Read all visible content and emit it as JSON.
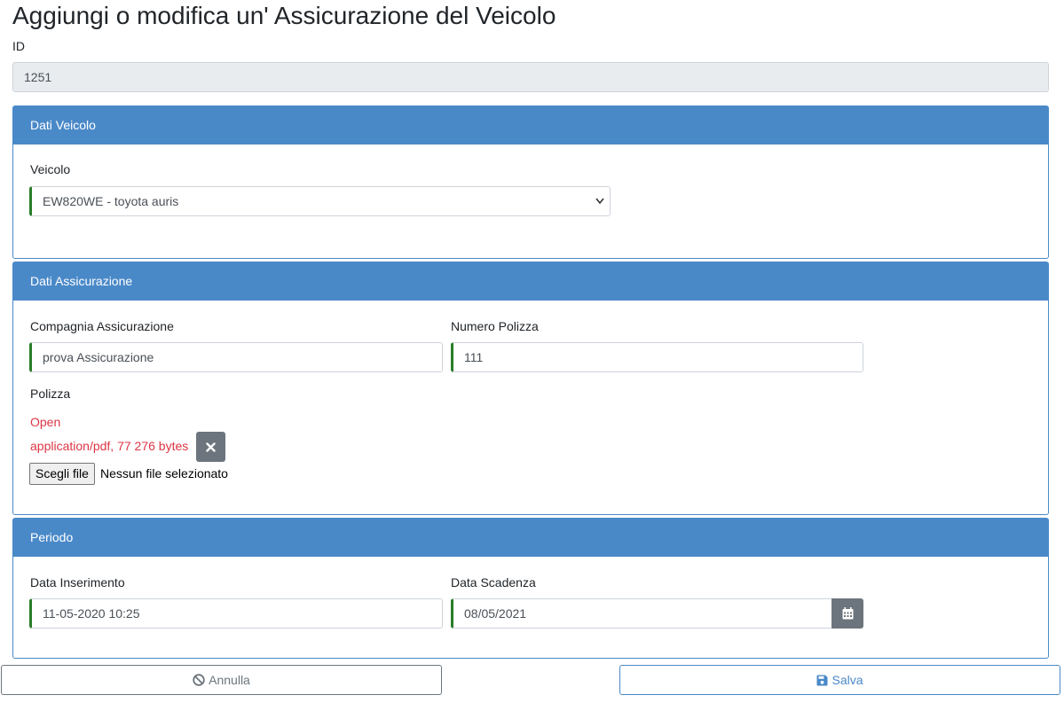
{
  "page": {
    "title": "Aggiungi o modifica un' Assicurazione del Veicolo"
  },
  "id_field": {
    "label": "ID",
    "value": "1251"
  },
  "vehicle_card": {
    "header": "Dati Veicolo",
    "vehicle_label": "Veicolo",
    "vehicle_value": "EW820WE - toyota auris"
  },
  "insurance_card": {
    "header": "Dati Assicurazione",
    "company_label": "Compagnia Assicurazione",
    "company_value": "prova Assicurazione",
    "policy_number_label": "Numero Polizza",
    "policy_number_value": "111",
    "policy_label": "Polizza",
    "open_link": "Open",
    "file_info": "application/pdf, 77 276 bytes",
    "choose_file_label": "Scegli file",
    "no_file_text": "Nessun file selezionato"
  },
  "period_card": {
    "header": "Periodo",
    "insert_date_label": "Data Inserimento",
    "insert_date_value": "11-05-2020 10:25",
    "expiry_date_label": "Data Scadenza",
    "expiry_date_value": "08/05/2021"
  },
  "footer": {
    "cancel_label": "Annulla",
    "save_label": "Salva"
  },
  "colors": {
    "primary": "#4a89c8",
    "valid": "#2a7d2a",
    "danger": "#dc3545",
    "secondary": "#6c757d"
  }
}
